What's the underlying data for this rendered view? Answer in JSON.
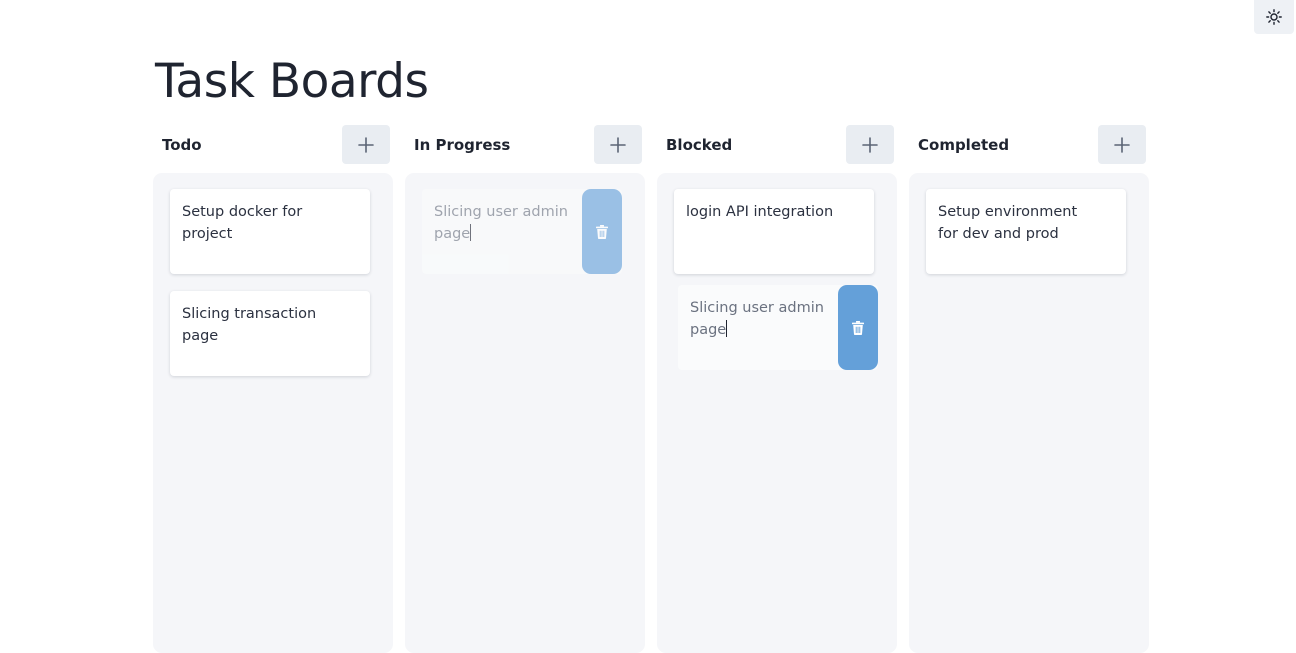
{
  "page": {
    "title": "Task Boards"
  },
  "theme_toggle": {
    "icon": "sun-icon"
  },
  "boards": [
    {
      "name": "Todo",
      "add_icon": "plus-icon",
      "cards": [
        {
          "text": "Setup docker for project"
        },
        {
          "text": "Slicing transaction page"
        }
      ]
    },
    {
      "name": "In Progress",
      "add_icon": "plus-icon",
      "cards": [
        {
          "text": "Slicing user admin page",
          "state": "editing-placeholder",
          "delete_icon": "trash-icon"
        }
      ]
    },
    {
      "name": "Blocked",
      "add_icon": "plus-icon",
      "cards": [
        {
          "text": "login API integration"
        },
        {
          "text": "Slicing user admin page",
          "state": "dragging",
          "delete_icon": "trash-icon"
        }
      ]
    },
    {
      "name": "Completed",
      "add_icon": "plus-icon",
      "cards": [
        {
          "text": "Setup environment for dev and prod"
        }
      ]
    }
  ],
  "colors": {
    "title": "#1f2430",
    "column_background": "#f5f6f9",
    "add_button_background": "#e9edf2",
    "delete_button": "#64a0d9",
    "card_background": "#ffffff"
  }
}
